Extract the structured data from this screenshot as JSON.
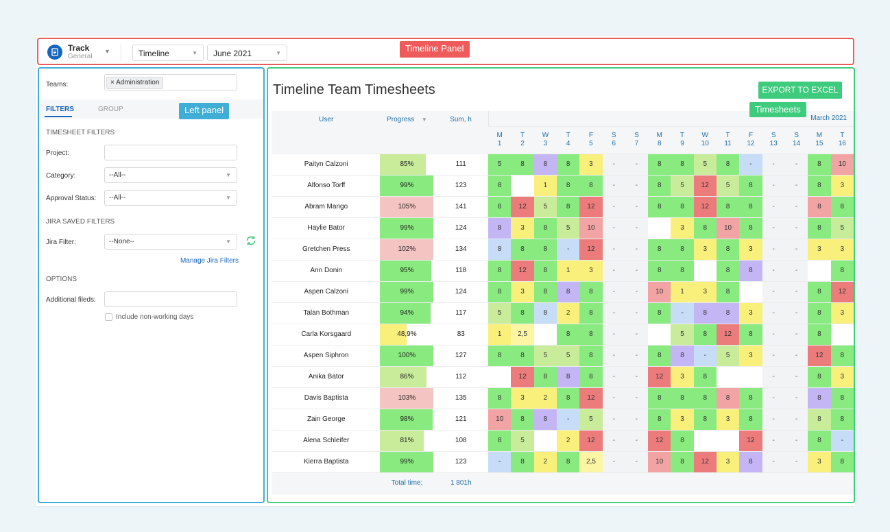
{
  "topbar": {
    "app_title": "Track",
    "app_subtitle": "General",
    "view_select": "Timeline",
    "month_select": "June 2021",
    "annotation": "Timeline Panel"
  },
  "left_panel": {
    "annotation": "Left panel",
    "teams_label": "Teams:",
    "teams_chip": "× Administration",
    "tabs": [
      "FILTERS",
      "GROUP"
    ],
    "timesheet_filters_title": "TIMESHEET FILTERS",
    "project_label": "Project:",
    "project_value": "",
    "category_label": "Category:",
    "category_value": "--All--",
    "approval_label": "Approval Status:",
    "approval_value": "--All--",
    "jira_saved_title": "JIRA SAVED FILTERS",
    "jira_filter_label": "Jira Filter:",
    "jira_filter_value": "--None--",
    "manage_link": "Manage Jira Filters",
    "options_title": "OPTIONS",
    "additional_label": "Additional fileds:",
    "additional_value": "",
    "non_working_label": "Include non-working days"
  },
  "main": {
    "annotation": "Timesheets",
    "title": "Timeline Team Timesheets",
    "export_label": "EXPORT TO EXCEL",
    "columns": {
      "user": "User",
      "progress": "Progress",
      "sum": "Sum, h",
      "month": "March 2021"
    },
    "days": [
      {
        "d": "M",
        "n": "1"
      },
      {
        "d": "T",
        "n": "2"
      },
      {
        "d": "W",
        "n": "3"
      },
      {
        "d": "T",
        "n": "4"
      },
      {
        "d": "F",
        "n": "5"
      },
      {
        "d": "S",
        "n": "6"
      },
      {
        "d": "S",
        "n": "7"
      },
      {
        "d": "M",
        "n": "8"
      },
      {
        "d": "T",
        "n": "9"
      },
      {
        "d": "W",
        "n": "10"
      },
      {
        "d": "T",
        "n": "11"
      },
      {
        "d": "F",
        "n": "12"
      },
      {
        "d": "S",
        "n": "13"
      },
      {
        "d": "S",
        "n": "14"
      },
      {
        "d": "M",
        "n": "15"
      },
      {
        "d": "T",
        "n": "16"
      }
    ],
    "rows": [
      {
        "user": "Paityn Calzoni",
        "progress": "85%",
        "pct": 85,
        "sum": "111",
        "cells": [
          [
            "5",
            "g"
          ],
          [
            "8",
            "g"
          ],
          [
            "8",
            "p"
          ],
          [
            "8",
            "g"
          ],
          [
            "3",
            "y"
          ],
          [
            "-",
            "x"
          ],
          [
            "-",
            "x"
          ],
          [
            "8",
            "g"
          ],
          [
            "8",
            "g"
          ],
          [
            "5",
            "lg"
          ],
          [
            "8",
            "g"
          ],
          [
            "-",
            "b"
          ],
          [
            "-",
            "x"
          ],
          [
            "-",
            "x"
          ],
          [
            "8",
            "g"
          ],
          [
            "10",
            "pk"
          ]
        ]
      },
      {
        "user": "Alfonso Torff",
        "progress": "99%",
        "pct": 99,
        "sum": "123",
        "cells": [
          [
            "8",
            "g"
          ],
          [
            "",
            "w"
          ],
          [
            "1",
            "y"
          ],
          [
            "8",
            "g"
          ],
          [
            "8",
            "g"
          ],
          [
            "-",
            "x"
          ],
          [
            "-",
            "x"
          ],
          [
            "8",
            "g"
          ],
          [
            "5",
            "lg"
          ],
          [
            "12",
            "r"
          ],
          [
            "5",
            "lg"
          ],
          [
            "8",
            "g"
          ],
          [
            "-",
            "x"
          ],
          [
            "-",
            "x"
          ],
          [
            "8",
            "g"
          ],
          [
            "3",
            "y"
          ]
        ]
      },
      {
        "user": "Abram Mango",
        "progress": "105%",
        "pct": 100,
        "sum": "141",
        "cells": [
          [
            "8",
            "g"
          ],
          [
            "12",
            "r"
          ],
          [
            "5",
            "lg"
          ],
          [
            "8",
            "g"
          ],
          [
            "12",
            "r"
          ],
          [
            "-",
            "x"
          ],
          [
            "-",
            "x"
          ],
          [
            "8",
            "g"
          ],
          [
            "8",
            "g"
          ],
          [
            "12",
            "r"
          ],
          [
            "8",
            "g"
          ],
          [
            "8",
            "g"
          ],
          [
            "-",
            "x"
          ],
          [
            "-",
            "x"
          ],
          [
            "8",
            "pk"
          ],
          [
            "8",
            "g"
          ]
        ]
      },
      {
        "user": "Haylie Bator",
        "progress": "99%",
        "pct": 99,
        "sum": "124",
        "cells": [
          [
            "8",
            "p"
          ],
          [
            "3",
            "y"
          ],
          [
            "8",
            "g"
          ],
          [
            "5",
            "lg"
          ],
          [
            "10",
            "pk"
          ],
          [
            "-",
            "x"
          ],
          [
            "-",
            "x"
          ],
          [
            "",
            "w"
          ],
          [
            "3",
            "y"
          ],
          [
            "8",
            "g"
          ],
          [
            "10",
            "pk"
          ],
          [
            "8",
            "g"
          ],
          [
            "-",
            "x"
          ],
          [
            "-",
            "x"
          ],
          [
            "8",
            "g"
          ],
          [
            "5",
            "lg"
          ]
        ]
      },
      {
        "user": "Gretchen Press",
        "progress": "102%",
        "pct": 100,
        "sum": "134",
        "cells": [
          [
            "8",
            "b"
          ],
          [
            "8",
            "g"
          ],
          [
            "8",
            "g"
          ],
          [
            "-",
            "b"
          ],
          [
            "12",
            "r"
          ],
          [
            "-",
            "x"
          ],
          [
            "-",
            "x"
          ],
          [
            "8",
            "g"
          ],
          [
            "8",
            "g"
          ],
          [
            "3",
            "y"
          ],
          [
            "8",
            "g"
          ],
          [
            "3",
            "y"
          ],
          [
            "-",
            "x"
          ],
          [
            "-",
            "x"
          ],
          [
            "3",
            "y"
          ],
          [
            "3",
            "y"
          ]
        ]
      },
      {
        "user": "Ann Donin",
        "progress": "95%",
        "pct": 95,
        "sum": "118",
        "cells": [
          [
            "8",
            "g"
          ],
          [
            "12",
            "r"
          ],
          [
            "8",
            "g"
          ],
          [
            "1",
            "y"
          ],
          [
            "3",
            "y"
          ],
          [
            "-",
            "x"
          ],
          [
            "-",
            "x"
          ],
          [
            "8",
            "g"
          ],
          [
            "8",
            "g"
          ],
          [
            "",
            "w"
          ],
          [
            "8",
            "g"
          ],
          [
            "8",
            "p"
          ],
          [
            "-",
            "x"
          ],
          [
            "-",
            "x"
          ],
          [
            "",
            "w"
          ],
          [
            "8",
            "g"
          ]
        ]
      },
      {
        "user": "Aspen Calzoni",
        "progress": "99%",
        "pct": 99,
        "sum": "124",
        "cells": [
          [
            "8",
            "g"
          ],
          [
            "3",
            "y"
          ],
          [
            "8",
            "g"
          ],
          [
            "8",
            "p"
          ],
          [
            "8",
            "g"
          ],
          [
            "-",
            "x"
          ],
          [
            "-",
            "x"
          ],
          [
            "10",
            "pk"
          ],
          [
            "1",
            "y"
          ],
          [
            "3",
            "y"
          ],
          [
            "8",
            "g"
          ],
          [
            "",
            "w"
          ],
          [
            "-",
            "x"
          ],
          [
            "-",
            "x"
          ],
          [
            "8",
            "g"
          ],
          [
            "12",
            "r"
          ]
        ]
      },
      {
        "user": "Talan Bothman",
        "progress": "94%",
        "pct": 94,
        "sum": "117",
        "cells": [
          [
            "5",
            "lg"
          ],
          [
            "8",
            "g"
          ],
          [
            "8",
            "b"
          ],
          [
            "2",
            "y"
          ],
          [
            "8",
            "g"
          ],
          [
            "-",
            "x"
          ],
          [
            "-",
            "x"
          ],
          [
            "8",
            "g"
          ],
          [
            "-",
            "b"
          ],
          [
            "8",
            "p"
          ],
          [
            "8",
            "p"
          ],
          [
            "3",
            "y"
          ],
          [
            "-",
            "x"
          ],
          [
            "-",
            "x"
          ],
          [
            "8",
            "g"
          ],
          [
            "3",
            "y"
          ]
        ]
      },
      {
        "user": "Carla Korsgaard",
        "progress": "48,9%",
        "pct": 49,
        "sum": "83",
        "cells": [
          [
            "1",
            "y"
          ],
          [
            "2,5",
            "ly"
          ],
          [
            "",
            "w"
          ],
          [
            "8",
            "g"
          ],
          [
            "8",
            "g"
          ],
          [
            "-",
            "x"
          ],
          [
            "-",
            "x"
          ],
          [
            "",
            "w"
          ],
          [
            "5",
            "lg"
          ],
          [
            "8",
            "g"
          ],
          [
            "12",
            "r"
          ],
          [
            "8",
            "g"
          ],
          [
            "-",
            "x"
          ],
          [
            "-",
            "x"
          ],
          [
            "8",
            "g"
          ],
          [
            "",
            "w"
          ]
        ]
      },
      {
        "user": "Aspen Siphron",
        "progress": "100%",
        "pct": 100,
        "sum": "127",
        "cells": [
          [
            "8",
            "g"
          ],
          [
            "8",
            "g"
          ],
          [
            "5",
            "lg"
          ],
          [
            "5",
            "lg"
          ],
          [
            "8",
            "g"
          ],
          [
            "-",
            "x"
          ],
          [
            "-",
            "x"
          ],
          [
            "8",
            "g"
          ],
          [
            "8",
            "p"
          ],
          [
            "-",
            "b"
          ],
          [
            "5",
            "lg"
          ],
          [
            "3",
            "y"
          ],
          [
            "-",
            "x"
          ],
          [
            "-",
            "x"
          ],
          [
            "12",
            "r"
          ],
          [
            "8",
            "g"
          ]
        ]
      },
      {
        "user": "Anika Bator",
        "progress": "86%",
        "pct": 86,
        "sum": "112",
        "cells": [
          [
            "",
            "w"
          ],
          [
            "12",
            "r"
          ],
          [
            "8",
            "g"
          ],
          [
            "8",
            "p"
          ],
          [
            "8",
            "g"
          ],
          [
            "-",
            "x"
          ],
          [
            "-",
            "x"
          ],
          [
            "12",
            "r"
          ],
          [
            "3",
            "y"
          ],
          [
            "8",
            "g"
          ],
          [
            "",
            "w"
          ],
          [
            "",
            "w"
          ],
          [
            "-",
            "x"
          ],
          [
            "-",
            "x"
          ],
          [
            "8",
            "g"
          ],
          [
            "3",
            "y"
          ]
        ]
      },
      {
        "user": "Davis Baptista",
        "progress": "103%",
        "pct": 100,
        "sum": "135",
        "cells": [
          [
            "8",
            "g"
          ],
          [
            "3",
            "y"
          ],
          [
            "2",
            "y"
          ],
          [
            "8",
            "g"
          ],
          [
            "12",
            "r"
          ],
          [
            "-",
            "x"
          ],
          [
            "-",
            "x"
          ],
          [
            "8",
            "g"
          ],
          [
            "8",
            "g"
          ],
          [
            "8",
            "g"
          ],
          [
            "8",
            "pk"
          ],
          [
            "8",
            "g"
          ],
          [
            "-",
            "x"
          ],
          [
            "-",
            "x"
          ],
          [
            "8",
            "p"
          ],
          [
            "8",
            "g"
          ]
        ]
      },
      {
        "user": "Zain George",
        "progress": "98%",
        "pct": 98,
        "sum": "121",
        "cells": [
          [
            "10",
            "pk"
          ],
          [
            "8",
            "g"
          ],
          [
            "8",
            "p"
          ],
          [
            "-",
            "b"
          ],
          [
            "5",
            "lg"
          ],
          [
            "-",
            "x"
          ],
          [
            "-",
            "x"
          ],
          [
            "8",
            "g"
          ],
          [
            "3",
            "y"
          ],
          [
            "8",
            "g"
          ],
          [
            "3",
            "y"
          ],
          [
            "8",
            "g"
          ],
          [
            "-",
            "x"
          ],
          [
            "-",
            "x"
          ],
          [
            "8",
            "lg"
          ],
          [
            "8",
            "g"
          ]
        ]
      },
      {
        "user": "Alena Schleifer",
        "progress": "81%",
        "pct": 81,
        "sum": "108",
        "cells": [
          [
            "8",
            "g"
          ],
          [
            "5",
            "lg"
          ],
          [
            "",
            "w"
          ],
          [
            "2",
            "y"
          ],
          [
            "12",
            "r"
          ],
          [
            "-",
            "x"
          ],
          [
            "-",
            "x"
          ],
          [
            "12",
            "r"
          ],
          [
            "8",
            "g"
          ],
          [
            "",
            "w"
          ],
          [
            "",
            "w"
          ],
          [
            "12",
            "r"
          ],
          [
            "-",
            "x"
          ],
          [
            "-",
            "x"
          ],
          [
            "8",
            "g"
          ],
          [
            "-",
            "b"
          ]
        ]
      },
      {
        "user": "Kierra Baptista",
        "progress": "99%",
        "pct": 99,
        "sum": "123",
        "cells": [
          [
            "-",
            "b"
          ],
          [
            "8",
            "g"
          ],
          [
            "2",
            "y"
          ],
          [
            "8",
            "g"
          ],
          [
            "2,5",
            "ly"
          ],
          [
            "-",
            "x"
          ],
          [
            "-",
            "x"
          ],
          [
            "10",
            "pk"
          ],
          [
            "8",
            "g"
          ],
          [
            "12",
            "r"
          ],
          [
            "3",
            "y"
          ],
          [
            "8",
            "p"
          ],
          [
            "-",
            "x"
          ],
          [
            "-",
            "x"
          ],
          [
            "3",
            "y"
          ],
          [
            "8",
            "g"
          ]
        ]
      }
    ],
    "total_label": "Total time:",
    "total_value": "1 801h"
  },
  "colors": {
    "accent_blue": "#1565c0",
    "panel_red": "#ea5b5b",
    "panel_blue": "#3eaed6",
    "panel_green": "#3fcb7d"
  }
}
